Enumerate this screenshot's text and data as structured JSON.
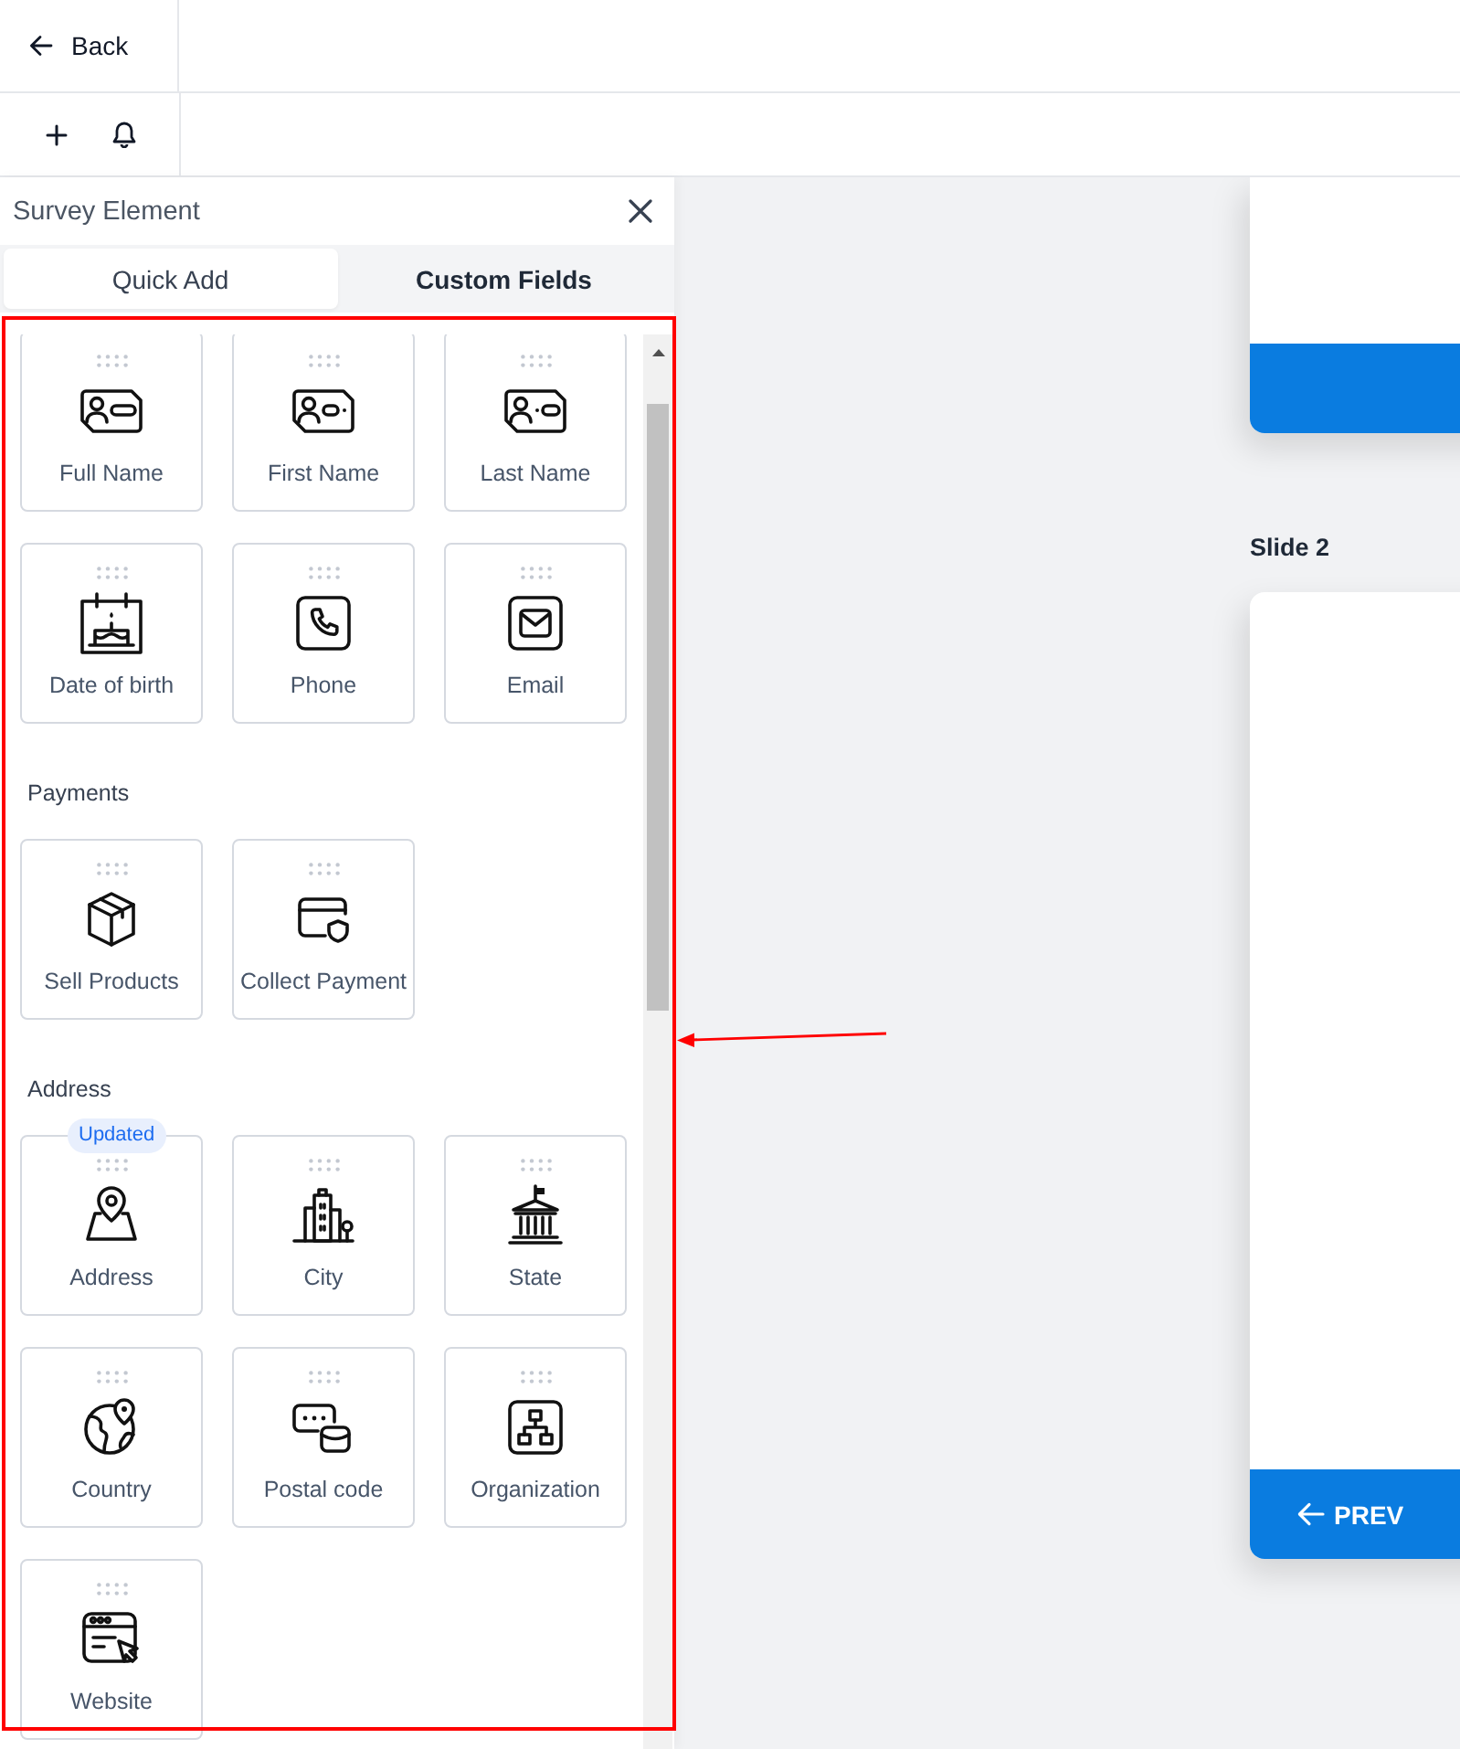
{
  "top_bar": {
    "back_button": "Back"
  },
  "panel": {
    "title": "Survey Element",
    "tabs": [
      {
        "label": "Quick Add",
        "selected": true
      },
      {
        "label": "Custom Fields",
        "selected": false
      }
    ],
    "sections": [
      {
        "items": [
          {
            "label": "Full Name",
            "kind": "fullname"
          },
          {
            "label": "First Name",
            "kind": "firstname"
          },
          {
            "label": "Last Name",
            "kind": "lastname"
          },
          {
            "label": "Date of birth",
            "kind": "birthdate"
          },
          {
            "label": "Phone",
            "kind": "phone"
          },
          {
            "label": "Email",
            "kind": "email"
          }
        ]
      },
      {
        "heading": "Payments",
        "items": [
          {
            "label": "Sell Products",
            "kind": "products"
          },
          {
            "label": "Collect Payment",
            "kind": "payment"
          }
        ]
      },
      {
        "heading": "Address",
        "items": [
          {
            "label": "Address",
            "kind": "address",
            "badge": "Updated"
          },
          {
            "label": "City",
            "kind": "city"
          },
          {
            "label": "State",
            "kind": "state"
          },
          {
            "label": "Country",
            "kind": "country"
          },
          {
            "label": "Postal code",
            "kind": "postal"
          },
          {
            "label": "Organization",
            "kind": "organization"
          },
          {
            "label": "Website",
            "kind": "website"
          }
        ]
      }
    ]
  },
  "canvas": {
    "slide_label": "Slide 2",
    "prev_button": "PREV"
  },
  "annotations": {
    "frame": true,
    "arrow": true
  }
}
